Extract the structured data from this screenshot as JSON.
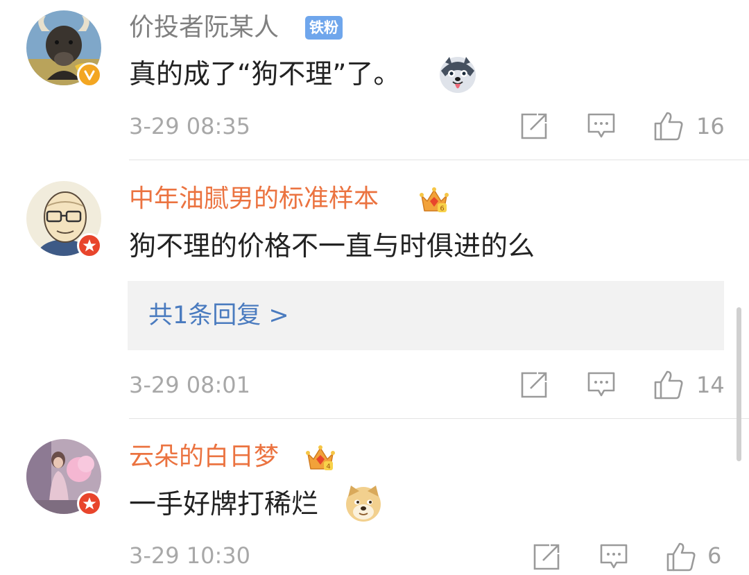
{
  "comments": [
    {
      "username": "价投者阮某人",
      "fan_tag": "铁粉",
      "text": "真的成了“狗不理”了。",
      "emoji_icon": "husky-face-emoji",
      "timestamp": "3-29 08:35",
      "likes": "16"
    },
    {
      "username": "中年油腻男的标准样本",
      "vip_level": "6",
      "text": "狗不理的价格不一直与时俱进的么",
      "replies_label": "共1条回复 >",
      "timestamp": "3-29 08:01",
      "likes": "14"
    },
    {
      "username": "云朵的白日梦",
      "vip_level": "4",
      "text": "一手好牌打稀烂",
      "emoji_icon": "doge-face-emoji",
      "timestamp": "3-29 10:30",
      "likes": "6"
    }
  ],
  "colors": {
    "vip_name": "#eb7340",
    "plain_name": "#808080",
    "fan_tag": "#6fa6ec",
    "reply_link": "#4a7bbf",
    "verified_badge": "#f3a622",
    "vip_badge": "#e8452c"
  }
}
